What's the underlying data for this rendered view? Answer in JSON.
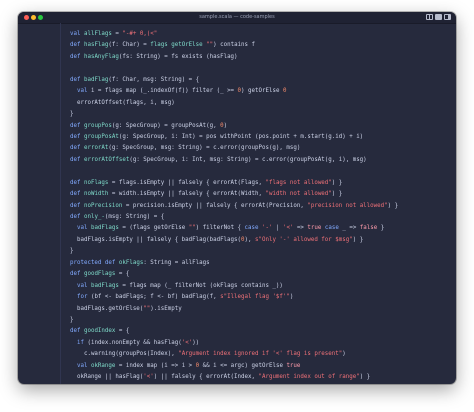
{
  "window": {
    "title": "sample.scala — code-samples",
    "layout_icons": [
      "sidebar-toggle-icon",
      "panel-layout-icon",
      "split-layout-icon"
    ]
  },
  "colors": {
    "background": "#262a3d",
    "keyword": "#82aaff",
    "function": "#7fdbca",
    "string": "#f07178",
    "number": "#f78c6c",
    "operator": "#ffcb6b",
    "identifier": "#cdd3e8"
  },
  "code": {
    "lines": [
      [
        [
          "kw",
          "val "
        ],
        [
          "fn",
          "allFlags"
        ],
        [
          "id",
          " = "
        ],
        [
          "str",
          "\"-#+ 0,(<\""
        ]
      ],
      [
        [
          "kw",
          "def "
        ],
        [
          "fn",
          "hasFlag"
        ],
        [
          "id",
          "(f: Char) = "
        ],
        [
          "fn",
          "flags getOrElse"
        ],
        [
          "id",
          " "
        ],
        [
          "str",
          "\"\""
        ],
        [
          "id",
          ") contains f"
        ]
      ],
      [
        [
          "kw",
          "def "
        ],
        [
          "fn",
          "hasAnyFlag"
        ],
        [
          "id",
          "(fs: String) = fs exists (hasFlag)"
        ]
      ],
      [
        [
          "id",
          ""
        ]
      ],
      [
        [
          "kw",
          "def "
        ],
        [
          "fn",
          "badFlag"
        ],
        [
          "id",
          "(f: Char, msg: String) = {"
        ]
      ],
      [
        [
          "id",
          "  "
        ],
        [
          "kw",
          "val "
        ],
        [
          "id",
          "i = flags map (_.indexOf(f)) filter (_ >= "
        ],
        [
          "num",
          "0"
        ],
        [
          "id",
          ") getOrElse "
        ],
        [
          "num",
          "0"
        ]
      ],
      [
        [
          "id",
          "  errorAtOffset(flags, i, msg)"
        ]
      ],
      [
        [
          "id",
          "}"
        ]
      ],
      [
        [
          "kw",
          "def "
        ],
        [
          "fn",
          "groupPos"
        ],
        [
          "id",
          "(g: SpecGroup) = groupPosAt(g, "
        ],
        [
          "num",
          "0"
        ],
        [
          "id",
          ")"
        ]
      ],
      [
        [
          "kw",
          "def "
        ],
        [
          "fn",
          "groupPosAt"
        ],
        [
          "id",
          "(g: SpecGroup, i: Int) = pos withPoint (pos.point + m.start(g.id) + i)"
        ]
      ],
      [
        [
          "kw",
          "def "
        ],
        [
          "fn",
          "errorAt"
        ],
        [
          "id",
          "(g: SpecGroup, msg: String) = c.error(groupPos(g), msg)"
        ]
      ],
      [
        [
          "kw",
          "def "
        ],
        [
          "fn",
          "errorAtOffset"
        ],
        [
          "id",
          "(g: SpecGroup, i: Int, msg: String) = c.error(groupPosAt(g, i), msg)"
        ]
      ],
      [
        [
          "id",
          ""
        ]
      ],
      [
        [
          "kw",
          "def "
        ],
        [
          "fn",
          "noFlags"
        ],
        [
          "id",
          " = flags.isEmpty || falsely { errorAt(Flags, "
        ],
        [
          "str",
          "\"flags not allowed\""
        ],
        [
          "id",
          ") }"
        ]
      ],
      [
        [
          "kw",
          "def "
        ],
        [
          "fn",
          "noWidth"
        ],
        [
          "id",
          " = width.isEmpty || falsely { errorAt(Width, "
        ],
        [
          "str",
          "\"width not allowed\""
        ],
        [
          "id",
          ") }"
        ]
      ],
      [
        [
          "kw",
          "def "
        ],
        [
          "fn",
          "noPrecision"
        ],
        [
          "id",
          " = precision.isEmpty || falsely { errorAt(Precision, "
        ],
        [
          "str",
          "\"precision not allowed\""
        ],
        [
          "id",
          ") }"
        ]
      ],
      [
        [
          "kw",
          "def "
        ],
        [
          "fn",
          "only_-"
        ],
        [
          "id",
          "(msg: String) = {"
        ]
      ],
      [
        [
          "id",
          "  "
        ],
        [
          "kw",
          "val "
        ],
        [
          "fn",
          "badFlags"
        ],
        [
          "id",
          " = (flags getOrElse "
        ],
        [
          "str",
          "\"\""
        ],
        [
          "id",
          ") filterNot { "
        ],
        [
          "kw",
          "case "
        ],
        [
          "str",
          "'-'"
        ],
        [
          "id",
          " | "
        ],
        [
          "str",
          "'<'"
        ],
        [
          "id",
          " => "
        ],
        [
          "bool",
          "true"
        ],
        [
          "id",
          " "
        ],
        [
          "kw",
          "case "
        ],
        [
          "id",
          "_ => "
        ],
        [
          "bool",
          "false"
        ],
        [
          "id",
          " }"
        ]
      ],
      [
        [
          "id",
          "  badFlags.isEmpty || falsely { badFlag(badFlags("
        ],
        [
          "num",
          "0"
        ],
        [
          "id",
          "), "
        ],
        [
          "str",
          "s\"Only '-' allowed for $msg\""
        ],
        [
          "id",
          ") }"
        ]
      ],
      [
        [
          "id",
          "}"
        ]
      ],
      [
        [
          "kw",
          "protected def "
        ],
        [
          "fn",
          "okFlags"
        ],
        [
          "id",
          ": String = allFlags"
        ]
      ],
      [
        [
          "kw",
          "def "
        ],
        [
          "fn",
          "goodFlags"
        ],
        [
          "id",
          " = {"
        ]
      ],
      [
        [
          "id",
          "  "
        ],
        [
          "kw",
          "val "
        ],
        [
          "fn",
          "badFlags"
        ],
        [
          "id",
          " = flags map (_ filterNot (okFlags contains _))"
        ]
      ],
      [
        [
          "id",
          "  "
        ],
        [
          "kw",
          "for "
        ],
        [
          "id",
          "(bf <- badFlags; f <- bf) badFlag(f, "
        ],
        [
          "str",
          "s\"Illegal flag '$f'\""
        ],
        [
          "id",
          ")"
        ]
      ],
      [
        [
          "id",
          "  badFlags.getOrElse("
        ],
        [
          "str",
          "\"\""
        ],
        [
          "id",
          ").isEmpty"
        ]
      ],
      [
        [
          "id",
          "}"
        ]
      ],
      [
        [
          "kw",
          "def "
        ],
        [
          "fn",
          "goodIndex"
        ],
        [
          "id",
          " = {"
        ]
      ],
      [
        [
          "id",
          "  "
        ],
        [
          "kw",
          "if "
        ],
        [
          "id",
          "(index.nonEmpty && hasFlag("
        ],
        [
          "str",
          "'<'"
        ],
        [
          "id",
          "))"
        ]
      ],
      [
        [
          "id",
          "    c.warning(groupPos(Index), "
        ],
        [
          "str",
          "\"Argument index ignored if '<' flag is present\""
        ],
        [
          "id",
          ")"
        ]
      ],
      [
        [
          "id",
          "  "
        ],
        [
          "kw",
          "val "
        ],
        [
          "fn",
          "okRange"
        ],
        [
          "id",
          " = index map (i => i > "
        ],
        [
          "num",
          "0"
        ],
        [
          "id",
          " && i <= argc) getOrElse "
        ],
        [
          "bool",
          "true"
        ]
      ],
      [
        [
          "id",
          "  okRange || hasFlag("
        ],
        [
          "str",
          "'<'"
        ],
        [
          "id",
          ") || falsely { errorAt(Index, "
        ],
        [
          "str",
          "\"Argument index out of range\""
        ],
        [
          "id",
          ") }"
        ]
      ],
      [
        [
          "id",
          "}"
        ]
      ]
    ]
  }
}
